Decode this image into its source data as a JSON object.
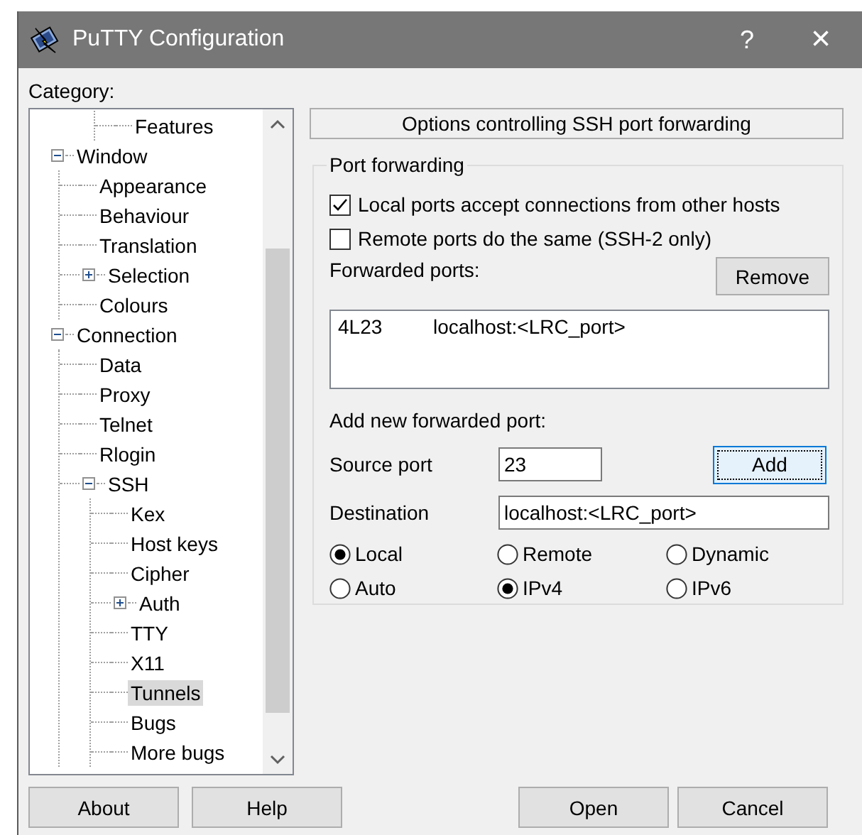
{
  "window": {
    "title": "PuTTY Configuration",
    "help_button": "?",
    "close_button": "×"
  },
  "category_label": "Category:",
  "tree": [
    {
      "children": [
        {
          "label": "Features",
          "selected": false
        }
      ]
    },
    {
      "label": "Window",
      "expandable": true,
      "expanded": true,
      "selected": false,
      "children": [
        {
          "label": "Appearance",
          "selected": false
        },
        {
          "label": "Behaviour",
          "selected": false
        },
        {
          "label": "Translation",
          "selected": false
        },
        {
          "label": "Selection",
          "expandable": true,
          "expanded": false,
          "selected": false
        },
        {
          "label": "Colours",
          "selected": false
        }
      ]
    },
    {
      "label": "Connection",
      "expandable": true,
      "expanded": true,
      "selected": false,
      "children": [
        {
          "label": "Data",
          "selected": false
        },
        {
          "label": "Proxy",
          "selected": false
        },
        {
          "label": "Telnet",
          "selected": false
        },
        {
          "label": "Rlogin",
          "selected": false
        },
        {
          "label": "SSH",
          "expandable": true,
          "expanded": true,
          "selected": false,
          "children": [
            {
              "label": "Kex",
              "selected": false
            },
            {
              "label": "Host keys",
              "selected": false
            },
            {
              "label": "Cipher",
              "selected": false
            },
            {
              "label": "Auth",
              "expandable": true,
              "expanded": false,
              "selected": false
            },
            {
              "label": "TTY",
              "selected": false
            },
            {
              "label": "X11",
              "selected": false
            },
            {
              "label": "Tunnels",
              "selected": true
            },
            {
              "label": "Bugs",
              "selected": false
            },
            {
              "label": "More bugs",
              "selected": false
            }
          ]
        }
      ]
    }
  ],
  "panel": {
    "header": "Options controlling SSH port forwarding",
    "group_title": "Port forwarding",
    "checkboxes": [
      {
        "label": "Local ports accept connections from other hosts",
        "checked": true
      },
      {
        "label": "Remote ports do the same (SSH-2 only)",
        "checked": false
      }
    ],
    "forwarded_label": "Forwarded ports:",
    "remove_button": "Remove",
    "forwarded": [
      {
        "source": "4L23",
        "destination": "localhost:<LRC_port>"
      }
    ],
    "add_label": "Add new forwarded port:",
    "source_port": {
      "label": "Source port",
      "value": "23"
    },
    "add_button": {
      "label": "Add",
      "focused": true
    },
    "destination": {
      "label": "Destination",
      "value": "localhost:<LRC_port>"
    },
    "direction": [
      {
        "label": "Local",
        "selected": true
      },
      {
        "label": "Remote",
        "selected": false
      },
      {
        "label": "Dynamic",
        "selected": false
      }
    ],
    "ip_version": [
      {
        "label": "Auto",
        "selected": false
      },
      {
        "label": "IPv4",
        "selected": true
      },
      {
        "label": "IPv6",
        "selected": false
      }
    ]
  },
  "buttons": [
    "About",
    "Help",
    "Open",
    "Cancel"
  ]
}
